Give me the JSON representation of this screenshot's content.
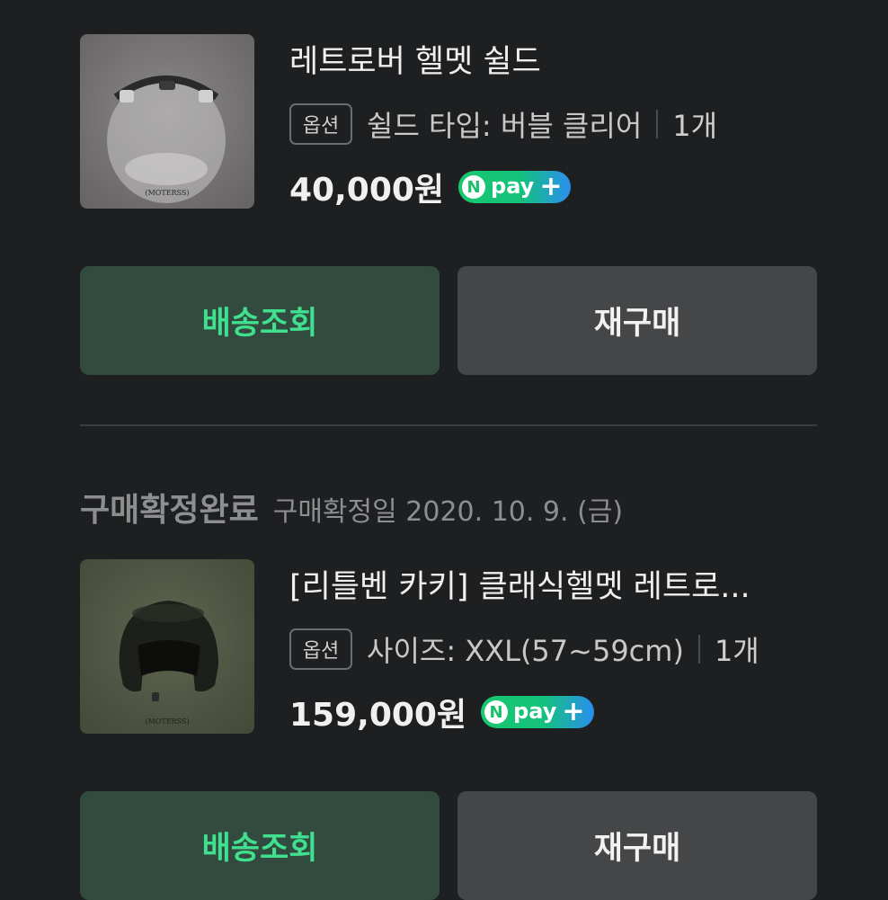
{
  "orders": [
    {
      "title": "레트로버 헬멧 쉴드",
      "option_tag": "옵션",
      "option_text": "쉴드 타입: 버블 클리어",
      "quantity": "1개",
      "price": "40,000원",
      "thumb_logo": "(MOTERSS)",
      "buttons": {
        "track": "배송조회",
        "rebuy": "재구매"
      }
    },
    {
      "status": "구매확정완료",
      "status_date": "구매확정일 2020. 10. 9. (금)",
      "title": "[리틀벤 카키] 클래식헬멧 레트로...",
      "option_tag": "옵션",
      "option_text": "사이즈: XXL(57~59cm)",
      "quantity": "1개",
      "price": "159,000원",
      "thumb_logo": "(MOTERSS)",
      "buttons": {
        "track": "배송조회",
        "rebuy": "재구매"
      }
    }
  ],
  "npay": {
    "n": "N",
    "label": "pay",
    "plus": "+"
  },
  "colors": {
    "background": "#1e1f20",
    "track_bg": "#334a3f",
    "track_text": "#3fe08e",
    "rebuy_bg": "#444648",
    "npay_green": "#19c76f",
    "npay_blue": "#2a8ef0"
  }
}
